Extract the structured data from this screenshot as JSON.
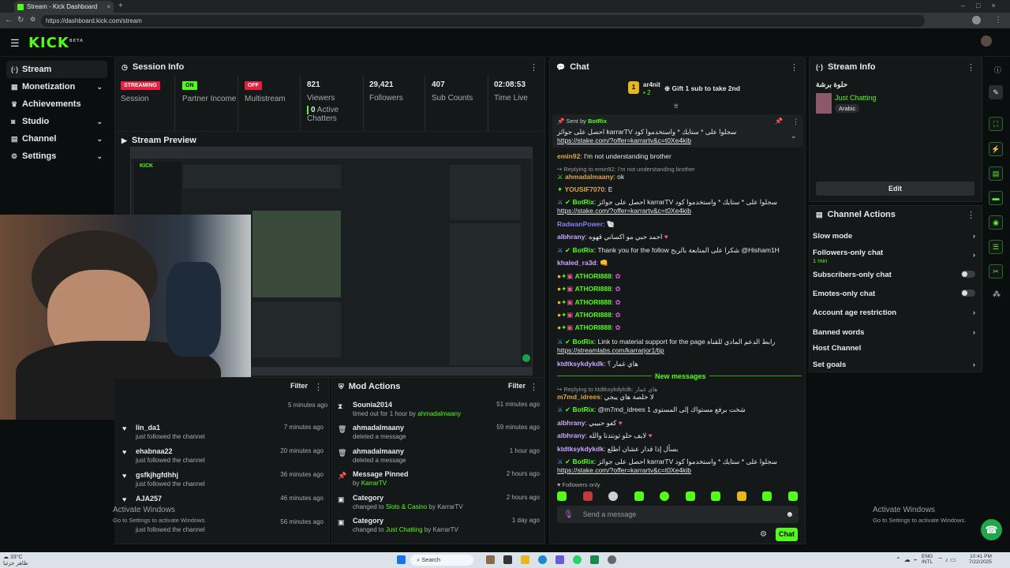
{
  "browser": {
    "tab_title": "Stream - Kick Dashboard",
    "url": "https://dashboard.kick.com/stream"
  },
  "header": {
    "logo": "KICK",
    "logo_sup": "BETA"
  },
  "sidebar": {
    "items": [
      {
        "label": "Stream"
      },
      {
        "label": "Monetization"
      },
      {
        "label": "Achievements"
      },
      {
        "label": "Studio"
      },
      {
        "label": "Channel"
      },
      {
        "label": "Settings"
      }
    ]
  },
  "session": {
    "title": "Session Info",
    "streaming_badge": "STREAMING",
    "session_label": "Session",
    "partner_badge": "ON",
    "partner_label": "Partner Income",
    "multi_badge": "OFF",
    "multi_label": "Multistream",
    "viewers_value": "821",
    "viewers_label": "Viewers",
    "active_value": "0",
    "active_label": "Active",
    "chatters_label": "Chatters",
    "followers_value": "29,421",
    "followers_label": "Followers",
    "subs_value": "407",
    "subs_label": "Sub Counts",
    "time_value": "02:08:53",
    "time_label": "Time Live"
  },
  "preview": {
    "title": "Stream Preview"
  },
  "activity": {
    "filter": "Filter",
    "first_time": "5 minutes ago",
    "rows": [
      {
        "name": "lin_da1",
        "sub": "just followed the channel",
        "time": "7 minutes ago"
      },
      {
        "name": "ehabnaa22",
        "sub": "just followed the channel",
        "time": "20 minutes ago"
      },
      {
        "name": "gsfkjhgfdhhj",
        "sub": "just followed the channel",
        "time": "36 minutes ago"
      },
      {
        "name": "AJA257",
        "sub": "",
        "time": "46 minutes ago"
      },
      {
        "name": "",
        "sub": "just followed the channel",
        "time": "56 minutes ago"
      }
    ]
  },
  "mod": {
    "title": "Mod Actions",
    "filter": "Filter",
    "rows": [
      {
        "name": "Sounia2014",
        "sub": "timed out for 1 hour by",
        "extra": "ahmadalmaany",
        "time": "51 minutes ago"
      },
      {
        "name": "ahmadalmaany",
        "sub": "deleted a message",
        "extra": "",
        "time": "59 minutes ago"
      },
      {
        "name": "ahmadalmaany",
        "sub": "deleted a message",
        "extra": "",
        "time": "1 hour ago"
      },
      {
        "name": "Message Pinned",
        "sub": "by",
        "extra": "KarrarTV",
        "time": "2 hours ago"
      },
      {
        "name": "Category",
        "sub": "changed to",
        "extra": "Slots & Casino",
        "extra2": "by KarrarTV",
        "time": "2 hours ago"
      },
      {
        "name": "Category",
        "sub": "changed to",
        "extra": "Just Chatting",
        "extra2": "by KarrarTV",
        "time": "1 day ago"
      }
    ]
  },
  "chat": {
    "title": "Chat",
    "gift_user": "ar4nit",
    "gift_count": "2",
    "gift_text": "Gift 1 sub to take 2nd",
    "pinned_by": "Sent by",
    "pinned_user": "BotRix",
    "pinned_text": "احصل على جوائز karrarTV سجلوا على * ستايك * واستخدموا كود",
    "pinned_link": "https://stake.com/?offer=karrartv&c=t0Xe4kib",
    "messages": [
      {
        "user": "emin92",
        "text": "I'm not understanding brother",
        "color": "#e0a64a"
      },
      {
        "reply": "Replying to emin92: I'm not understanding brother"
      },
      {
        "user": "ahmadalmaany",
        "text": "ok",
        "color": "#e0a64a"
      },
      {
        "user": "YOUSIF7070",
        "text": "E",
        "color": "#e0a64a"
      },
      {
        "user": "BotRix",
        "text": "احصل على جوائز karrarTV سجلوا على * ستايك * واستخدموا كود",
        "link": "https://stake.com/?offer=karrartv&c=t0Xe4kib",
        "color": "#53fc18"
      },
      {
        "user": "RadwanPower",
        "text": "",
        "color": "#8b7cf6"
      },
      {
        "user": "albhrany",
        "text": "احمد حبي مو اكساني قهوه",
        "color": "#c9a6ff"
      },
      {
        "user": "BotRix",
        "text": "Thank you for the follow شكرا على المتابعة بالربح @Hisham1H",
        "color": "#53fc18"
      },
      {
        "user": "khaled_ra3d",
        "text": "",
        "color": "#c9a6ff"
      },
      {
        "user": "ATHORI888",
        "text": "",
        "color": "#53fc18"
      },
      {
        "user": "ATHORI888",
        "text": "",
        "color": "#53fc18"
      },
      {
        "user": "ATHORI888",
        "text": "",
        "color": "#53fc18"
      },
      {
        "user": "ATHORI888",
        "text": "",
        "color": "#53fc18"
      },
      {
        "user": "ATHORI888",
        "text": "",
        "color": "#53fc18"
      },
      {
        "user": "BotRix",
        "text": "Link to material support for the page رابط الدعم المادي للقناة",
        "link": "https://streamlabs.com/karrarjor1/tip",
        "color": "#53fc18"
      },
      {
        "user": "ktdtksykdykdk",
        "text": "هاي غمار ؟",
        "color": "#c9a6ff"
      }
    ],
    "new_messages": "New messages",
    "messages2": [
      {
        "reply": "Replying to ktdtksykdykdk: هاي غمار"
      },
      {
        "user": "m7md_idrees",
        "text": "لا خلصة هاي يبجي",
        "color": "#e0a64a"
      },
      {
        "user": "BotRix",
        "text": "@m7md_idrees شخت برفع مستواك إلى المستوى 1",
        "color": "#53fc18"
      },
      {
        "user": "albhrany",
        "text": "كفو حبيبي",
        "color": "#c9a6ff"
      },
      {
        "user": "albhrany",
        "text": "لايف حلو ثونتدنا والله",
        "color": "#c9a6ff"
      },
      {
        "user": "ktdtksykdykdk",
        "text": "بسأل إذا قدار عشان اطلع",
        "color": "#c9a6ff"
      },
      {
        "user": "BotRix",
        "text": "احصل على جوائز karrarTV سجلوا على * ستايك * واستخدموا كود",
        "link": "https://stake.com/?offer=karrartv&c=t0Xe4kib",
        "color": "#53fc18"
      }
    ],
    "followers_only": "Followers only",
    "input_placeholder": "Send a message",
    "send_label": "Chat"
  },
  "stream_info": {
    "title": "Stream Info",
    "stream_title": "حلوة برشة",
    "category": "Just Chatting",
    "language": "Arabic",
    "edit": "Edit"
  },
  "channel_actions": {
    "title": "Channel Actions",
    "items": [
      {
        "label": "Slow mode",
        "sub": "",
        "kind": "chev"
      },
      {
        "label": "Followers-only chat",
        "sub": "1 min",
        "kind": "chev"
      },
      {
        "label": "Subscribers-only chat",
        "sub": "",
        "kind": "toggle"
      },
      {
        "label": "Emotes-only chat",
        "sub": "",
        "kind": "toggle"
      },
      {
        "label": "Account age restriction",
        "sub": "",
        "kind": "chev"
      },
      {
        "label": "Banned words",
        "sub": "",
        "kind": "chev"
      },
      {
        "label": "Host Channel",
        "sub": "",
        "kind": "none"
      },
      {
        "label": "Set goals",
        "sub": "",
        "kind": "chev"
      }
    ]
  },
  "windows": {
    "activate_title": "Activate Windows",
    "activate_sub": "Go to Settings to activate Windows.",
    "search": "Search",
    "time": "10:41 PM",
    "date": "7/22/2025",
    "lang1": "ENG",
    "lang2": "INTL",
    "weather_temp": "33°C",
    "weather_text": "ظاهر جزئيا"
  },
  "colors": {
    "accent": "#53fc18",
    "panel": "#151819",
    "bg": "#0b0e0f",
    "badge_red": "#e91e3f"
  }
}
